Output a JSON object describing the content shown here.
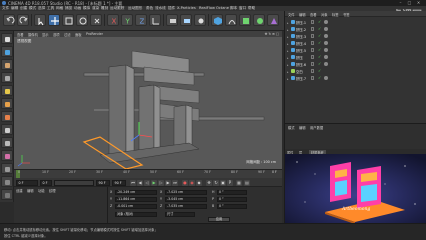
{
  "window": {
    "title": "CINEMA 4D R18.057 Studio (RC - R18) - [未标题 1 *] - 主要"
  },
  "menubar": {
    "items": [
      "文件",
      "编辑",
      "创建",
      "模式",
      "选择",
      "工具",
      "网格",
      "捕捉",
      "动画",
      "模拟",
      "渲染",
      "雕刻",
      "运动跟踪",
      "运动图形",
      "角色",
      "流水线",
      "插件",
      "X-Particles",
      "RealFlow",
      "Octane",
      "脚本",
      "窗口",
      "帮助"
    ]
  },
  "viewport": {
    "menu": [
      "查看",
      "摄像机",
      "显示",
      "选项",
      "过滤",
      "面板",
      "ProRender"
    ],
    "label": "透视视图",
    "grid_readout": "网格间距 : 100 cm",
    "bg_color": "#585858"
  },
  "timeline": {
    "ticks": [
      "0",
      "10 F",
      "20 F",
      "30 F",
      "40 F",
      "50 F",
      "60 F",
      "70 F",
      "80 F",
      "90 F"
    ],
    "end_label": "0 F"
  },
  "transport": {
    "start_field": "0 F",
    "current_field": "0 F",
    "end_field": "90 F",
    "max_field": "90 F"
  },
  "material_panel": {
    "tabs": [
      "创建",
      "编辑",
      "功能",
      "纹理"
    ]
  },
  "coordinates": {
    "rows": [
      {
        "axis": "X",
        "pos": "0 cm",
        "size": "-20.249 cm",
        "axis2": "X",
        "rot_label": "H",
        "rot": "0 °",
        "size2": "-7.025 cm"
      },
      {
        "axis": "Y",
        "pos": "0 cm",
        "size": "-11.864 cm",
        "axis2": "Y",
        "rot_label": "P",
        "rot": "0 °",
        "size2": "-3.045 cm"
      },
      {
        "axis": "Z",
        "pos": "0 cm",
        "size": "-0.001 cm",
        "axis2": "Z",
        "rot_label": "B",
        "rot": "0 °",
        "size2": "-7.035 cm"
      }
    ],
    "mode_object": "对象 (相对)",
    "mode_size": "尺寸",
    "apply_label": "应用"
  },
  "status": {
    "line1": "移动: 点击并拖动鼠标移动元素。按住 SHIFT 键量化移动；节点编辑模式时按住 SHIFT 键增加选择对象；",
    "line2": "按住 CTRL 键减少选择对象。"
  },
  "object_manager": {
    "menu": [
      "文件",
      "编辑",
      "查看",
      "对象",
      "标签",
      "书签"
    ],
    "objects": [
      {
        "name": "挤压.1",
        "icon_color": "#4fa3e0",
        "depth": 0
      },
      {
        "name": "挤压.2",
        "icon_color": "#4fa3e0",
        "depth": 0
      },
      {
        "name": "挤压.3",
        "icon_color": "#4fa3e0",
        "depth": 0
      },
      {
        "name": "挤压.4",
        "icon_color": "#4fa3e0",
        "depth": 0
      },
      {
        "name": "挤压.5",
        "icon_color": "#4fa3e0",
        "depth": 0
      },
      {
        "name": "挤压",
        "icon_color": "#4fa3e0",
        "depth": 0
      },
      {
        "name": "挤压.6",
        "icon_color": "#4fa3e0",
        "depth": 0
      },
      {
        "name": "空白",
        "icon_color": "#9bd35a",
        "depth": 0
      },
      {
        "name": "挤压.7",
        "icon_color": "#4fa3e0",
        "depth": 0
      }
    ]
  },
  "attributes": {
    "tabs": [
      "模式",
      "编辑",
      "用户数据"
    ],
    "mode_tabs": [
      "属性",
      "层"
    ]
  },
  "preview": {
    "tabs": [
      "属性",
      "层",
      "材质参考"
    ],
    "active_tab": 2,
    "glyph_colors": [
      "#ff3fa8",
      "#ffb347",
      "#5ad1ff"
    ],
    "signature": "Artbeomong"
  },
  "watermark": "虎课网",
  "colors": {
    "accent": "#4fa3e0",
    "check": "#5bd35b",
    "playhead": "#5b8c3a"
  }
}
